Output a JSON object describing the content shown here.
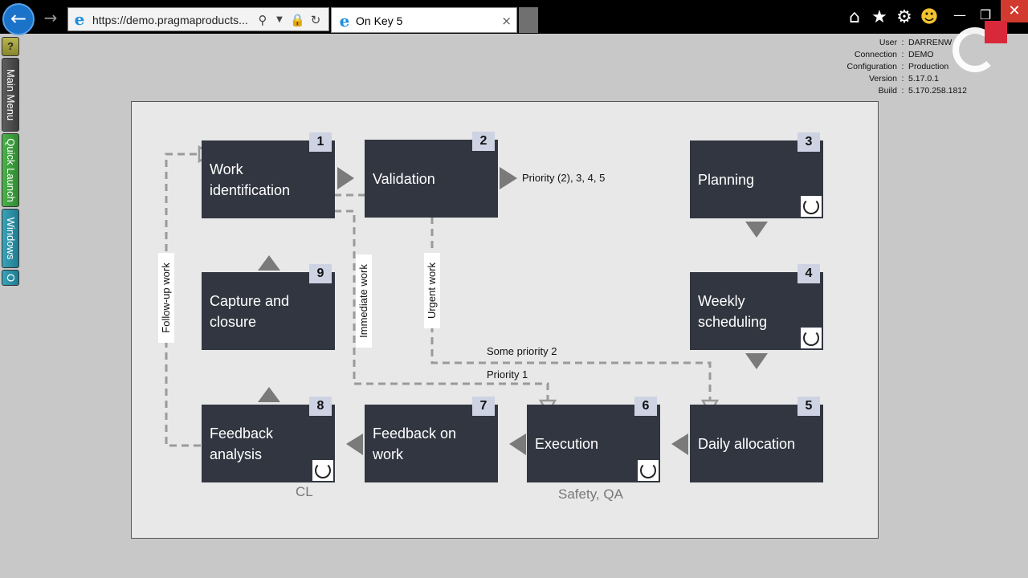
{
  "browser": {
    "url": "https://demo.pragmaproducts...",
    "tab_title": "On Key 5",
    "tab_close": "×",
    "icons": [
      "back-arrow-icon",
      "forward-arrow-icon",
      "search-icon",
      "dropdown-icon",
      "lock-icon",
      "refresh-icon",
      "home-icon",
      "favorites-star-icon",
      "settings-gear-icon",
      "smiley-feedback-icon"
    ]
  },
  "leftbar": {
    "help": "?",
    "main_menu": "Main Menu",
    "quick_launch": "Quick Launch",
    "windows": "Windows",
    "o": "O"
  },
  "info": {
    "rows": [
      {
        "key": "User",
        "value": "DARRENW"
      },
      {
        "key": "Connection",
        "value": "DEMO"
      },
      {
        "key": "Configuration",
        "value": "Production"
      },
      {
        "key": "Version",
        "value": "5.17.0.1"
      },
      {
        "key": "Build",
        "value": "5.170.258.1812"
      }
    ]
  },
  "diagram": {
    "steps": [
      {
        "num": "1",
        "title": "Work identification"
      },
      {
        "num": "2",
        "title": "Validation"
      },
      {
        "num": "3",
        "title": "Planning"
      },
      {
        "num": "4",
        "title": "Weekly scheduling"
      },
      {
        "num": "5",
        "title": "Daily allocation"
      },
      {
        "num": "6",
        "title": "Execution"
      },
      {
        "num": "7",
        "title": "Feedback on work"
      },
      {
        "num": "8",
        "title": "Feedback analysis"
      },
      {
        "num": "9",
        "title": "Capture and closure"
      }
    ],
    "labels": {
      "priority_list": "Priority (2), 3, 4, 5",
      "follow_up": "Follow-up work",
      "immediate": "Immediate work",
      "urgent": "Urgent work",
      "some_priority_2": "Some priority 2",
      "priority_1": "Priority 1",
      "cl": "CL",
      "safety_qa": "Safety, QA"
    },
    "colors": {
      "box": "#323640",
      "badge": "#cdd3e3",
      "arrow": "#7a7a7a",
      "dashed": "#9a9a9a"
    }
  }
}
